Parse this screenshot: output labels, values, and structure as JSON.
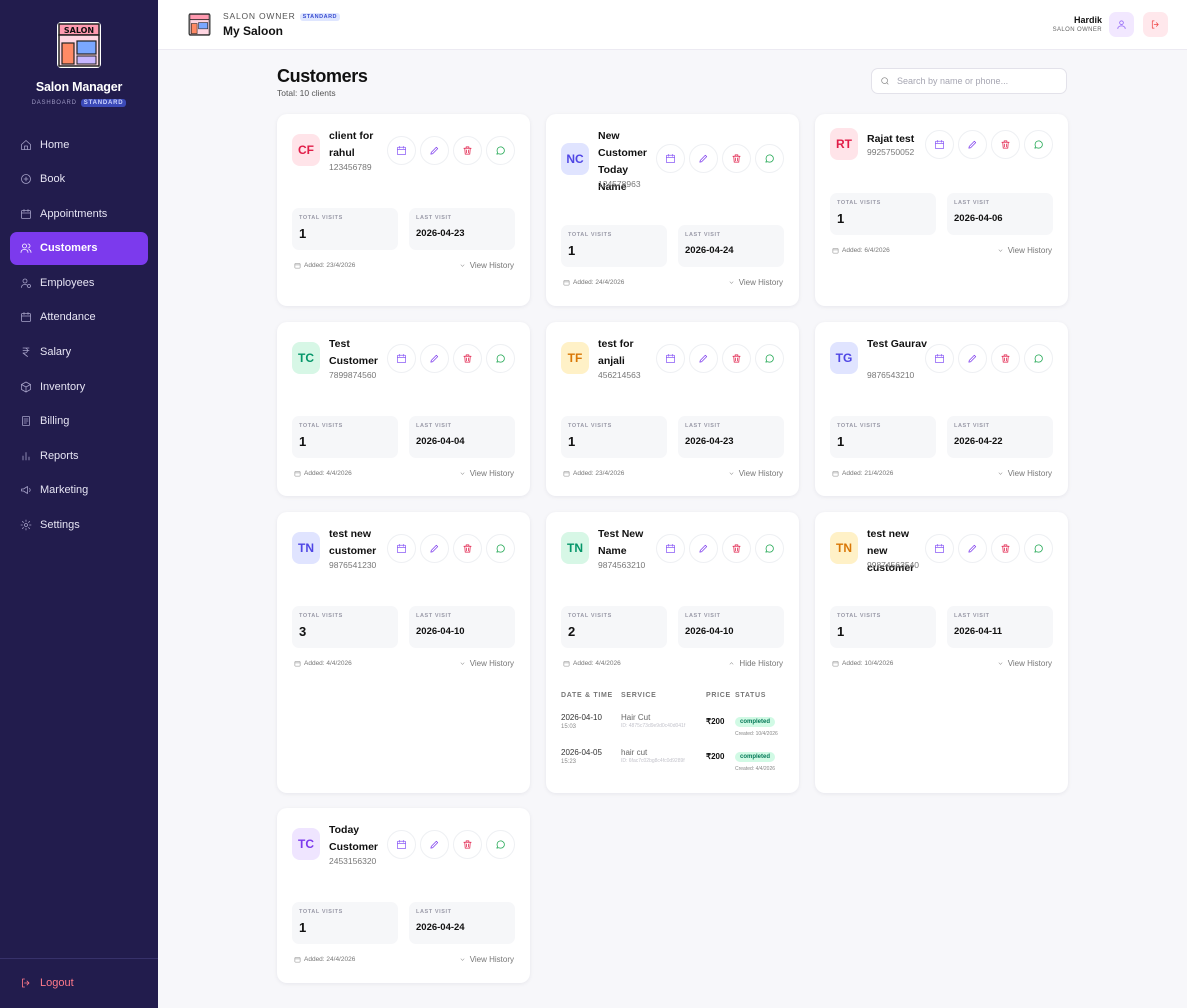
{
  "sidebar": {
    "brand": "Salon Manager",
    "logo_text": "SALON",
    "subtitle": "DASHBOARD",
    "plan_badge": "STANDARD",
    "items": [
      {
        "label": "Home",
        "icon": "home-icon"
      },
      {
        "label": "Book",
        "icon": "plus-circle-icon"
      },
      {
        "label": "Appointments",
        "icon": "calendar-icon"
      },
      {
        "label": "Customers",
        "icon": "users-icon",
        "active": true
      },
      {
        "label": "Employees",
        "icon": "user-cog-icon"
      },
      {
        "label": "Attendance",
        "icon": "calendar-check-icon"
      },
      {
        "label": "Salary",
        "icon": "rupee-icon"
      },
      {
        "label": "Inventory",
        "icon": "box-icon"
      },
      {
        "label": "Billing",
        "icon": "receipt-icon"
      },
      {
        "label": "Reports",
        "icon": "bar-chart-icon"
      },
      {
        "label": "Marketing",
        "icon": "megaphone-icon"
      },
      {
        "label": "Settings",
        "icon": "gear-icon"
      }
    ],
    "logout_label": "Logout"
  },
  "header": {
    "role": "SALON OWNER",
    "plan_badge": "STANDARD",
    "shop_name": "My Saloon",
    "user_name": "Hardik",
    "user_role": "SALON OWNER"
  },
  "page": {
    "title": "Customers",
    "total": "Total: 10 clients",
    "search_placeholder": "Search by name or phone..."
  },
  "labels": {
    "total_visits": "TOTAL VISITS",
    "last_visit": "LAST VISIT",
    "view_history": "View History",
    "hide_history": "Hide History",
    "col_date": "DATE & TIME",
    "col_service": "SERVICE",
    "col_price": "PRICE",
    "col_status": "STATUS"
  },
  "customers": [
    {
      "initials": "CF",
      "name": "client for rahul",
      "phone": "123456789",
      "visits": "1",
      "last_visit": "2026-04-23",
      "added": "Added: 23/4/2026",
      "color": "#e11d48",
      "bg": "#ffe4e9"
    },
    {
      "initials": "NC",
      "name": "New Customer Today Name",
      "phone": "124578963",
      "visits": "1",
      "last_visit": "2026-04-24",
      "added": "Added: 24/4/2026",
      "color": "#4f46e5",
      "bg": "#e0e4ff"
    },
    {
      "initials": "RT",
      "name": "Rajat test",
      "phone": "9925750052",
      "visits": "1",
      "last_visit": "2026-04-06",
      "added": "Added: 6/4/2026",
      "color": "#e11d48",
      "bg": "#ffe4e9"
    },
    {
      "initials": "TC",
      "name": "Test Customer",
      "phone": "7899874560",
      "visits": "1",
      "last_visit": "2026-04-04",
      "added": "Added: 4/4/2026",
      "color": "#059669",
      "bg": "#d7f7e6"
    },
    {
      "initials": "TF",
      "name": "test for anjali",
      "phone": "456214563",
      "visits": "1",
      "last_visit": "2026-04-23",
      "added": "Added: 23/4/2026",
      "color": "#d97706",
      "bg": "#fff1c7"
    },
    {
      "initials": "TG",
      "name": "Test Gaurav",
      "phone": "9876543210",
      "visits": "1",
      "last_visit": "2026-04-22",
      "added": "Added: 21/4/2026",
      "color": "#4f46e5",
      "bg": "#e0e4ff"
    },
    {
      "initials": "TN",
      "name": "test new customer",
      "phone": "9876541230",
      "visits": "3",
      "last_visit": "2026-04-10",
      "added": "Added: 4/4/2026",
      "color": "#4f46e5",
      "bg": "#e0e4ff"
    },
    {
      "initials": "TN",
      "name": "Test New Name",
      "phone": "9874563210",
      "visits": "2",
      "last_visit": "2026-04-10",
      "added": "Added: 4/4/2026",
      "color": "#059669",
      "bg": "#d7f7e6",
      "history_open": true,
      "history": [
        {
          "date": "2026-04-10",
          "time": "15:03",
          "service": "Hair Cut",
          "id": "ID: 4875c73d9e9d0c40d041f",
          "price": "₹200",
          "status": "completed",
          "created": "Created: 10/4/2026"
        },
        {
          "date": "2026-04-05",
          "time": "15:23",
          "service": "hair cut",
          "id": "ID: 6fac7c02bg8c4fc0d9289f",
          "price": "₹200",
          "status": "completed",
          "created": "Created: 4/4/2026"
        }
      ]
    },
    {
      "initials": "TN",
      "name": "test new new customer",
      "phone": "99874563540",
      "visits": "1",
      "last_visit": "2026-04-11",
      "added": "Added: 10/4/2026",
      "color": "#d97706",
      "bg": "#fff1c7"
    },
    {
      "initials": "TC",
      "name": "Today Customer",
      "phone": "2453156320",
      "visits": "1",
      "last_visit": "2026-04-24",
      "added": "Added: 24/4/2026",
      "color": "#7c3aed",
      "bg": "#efe5ff"
    }
  ]
}
